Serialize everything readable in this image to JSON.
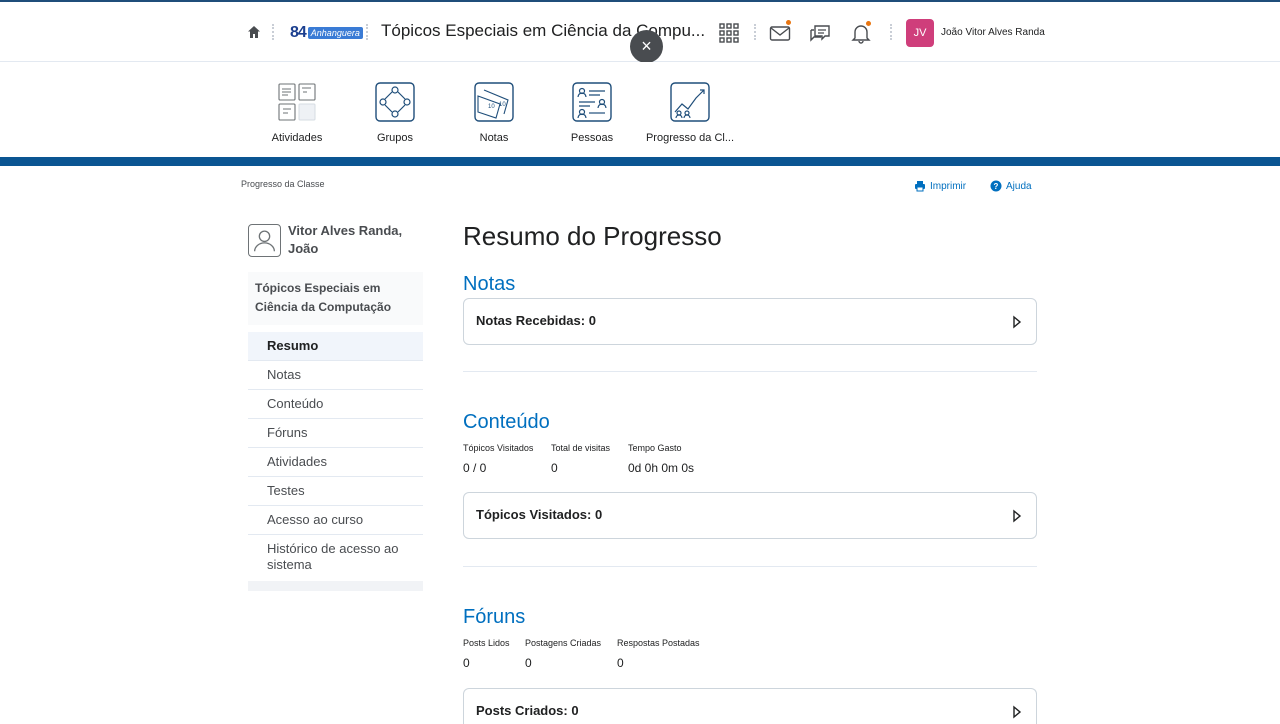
{
  "header": {
    "course_title": "Tópicos Especiais em Ciência da Compu...",
    "logo_number": "84",
    "logo_brand": "Anhanguera",
    "close_symbol": "×",
    "user_initials": "JV",
    "user_name": "João Vitor Alves Randa",
    "accent_color": "#cf3e7b",
    "notification_color": "#e87511"
  },
  "navbar": {
    "items": [
      {
        "label": "Atividades",
        "icon": "activities-icon"
      },
      {
        "label": "Grupos",
        "icon": "groups-icon"
      },
      {
        "label": "Notas",
        "icon": "grades-icon"
      },
      {
        "label": "Pessoas",
        "icon": "people-icon"
      },
      {
        "label": "Progresso da Cl...",
        "icon": "progress-icon"
      }
    ]
  },
  "breadcrumb": "Progresso da Classe",
  "actions": {
    "print": "Imprimir",
    "help": "Ajuda"
  },
  "sidebar": {
    "user_name": "Vitor Alves Randa, João",
    "course": "Tópicos Especiais em Ciência da Computação",
    "items": [
      {
        "label": "Resumo",
        "active": true
      },
      {
        "label": "Notas"
      },
      {
        "label": "Conteúdo"
      },
      {
        "label": "Fóruns"
      },
      {
        "label": "Atividades"
      },
      {
        "label": "Testes"
      },
      {
        "label": "Acesso ao curso"
      },
      {
        "label": "Histórico de acesso ao sistema"
      }
    ]
  },
  "main": {
    "title": "Resumo do Progresso",
    "grades": {
      "heading": "Notas",
      "card": "Notas Recebidas: 0"
    },
    "content": {
      "heading": "Conteúdo",
      "stats": [
        {
          "label": "Tópicos Visitados",
          "value": "0 / 0"
        },
        {
          "label": "Total de visitas",
          "value": "0"
        },
        {
          "label": "Tempo Gasto",
          "value": "0d 0h 0m 0s"
        }
      ],
      "card": "Tópicos Visitados: 0"
    },
    "forums": {
      "heading": "Fóruns",
      "stats": [
        {
          "label": "Posts Lidos",
          "value": "0"
        },
        {
          "label": "Postagens Criadas",
          "value": "0"
        },
        {
          "label": "Respostas Postadas",
          "value": "0"
        }
      ],
      "card": "Posts Criados: 0"
    }
  }
}
